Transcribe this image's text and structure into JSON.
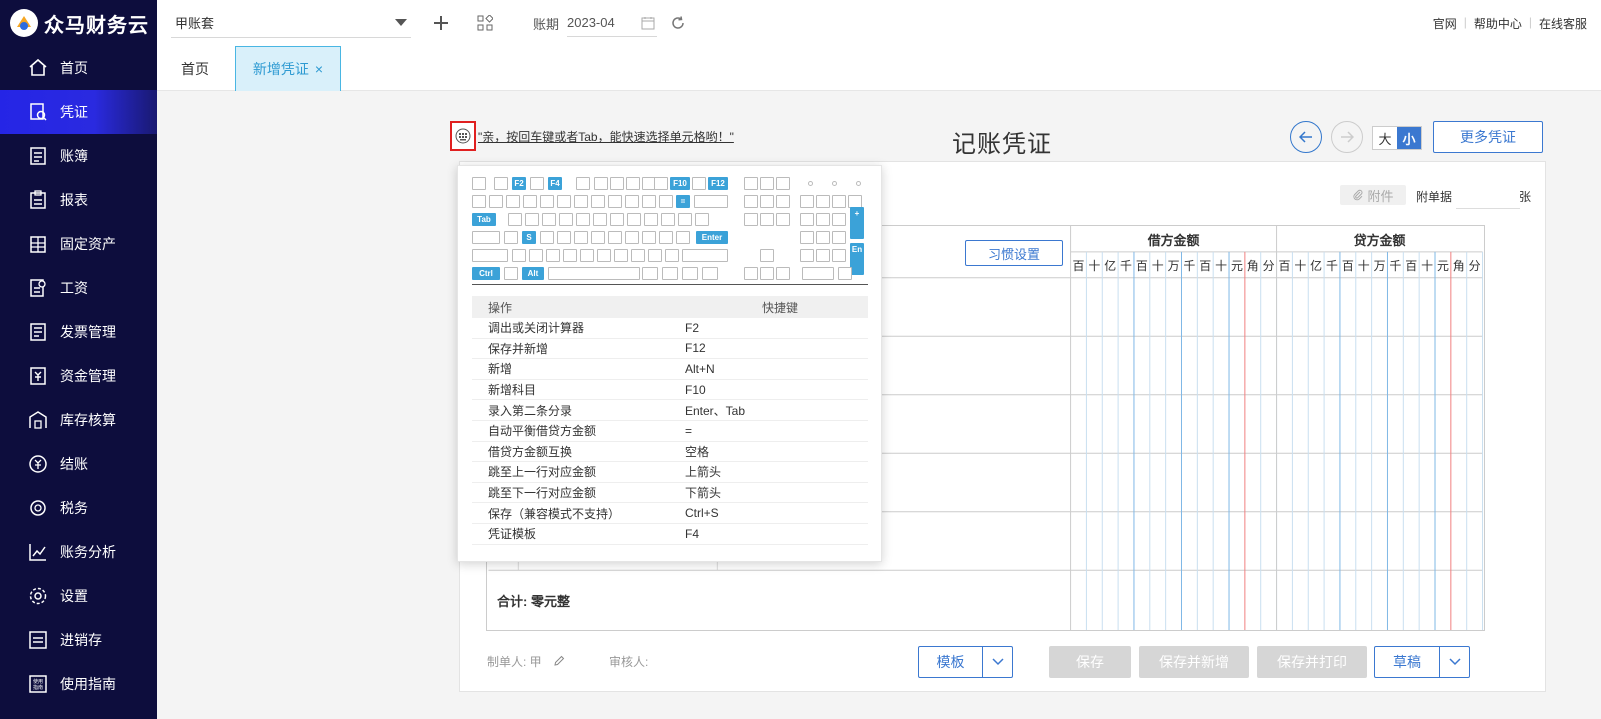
{
  "app": {
    "name": "众马财务云"
  },
  "sidebar": {
    "items": [
      {
        "label": "首页",
        "icon": "home-icon"
      },
      {
        "label": "凭证",
        "icon": "voucher-icon",
        "active": true
      },
      {
        "label": "账簿",
        "icon": "ledger-icon"
      },
      {
        "label": "报表",
        "icon": "report-icon"
      },
      {
        "label": "固定资产",
        "icon": "asset-icon"
      },
      {
        "label": "工资",
        "icon": "salary-icon"
      },
      {
        "label": "发票管理",
        "icon": "invoice-icon"
      },
      {
        "label": "资金管理",
        "icon": "fund-icon"
      },
      {
        "label": "库存核算",
        "icon": "inventory-icon"
      },
      {
        "label": "结账",
        "icon": "closing-icon"
      },
      {
        "label": "税务",
        "icon": "tax-icon"
      },
      {
        "label": "账务分析",
        "icon": "analysis-icon"
      },
      {
        "label": "设置",
        "icon": "settings-icon"
      },
      {
        "label": "进销存",
        "icon": "trade-icon"
      },
      {
        "label": "使用指南",
        "icon": "guide-icon"
      }
    ]
  },
  "topbar": {
    "account": "甲账套",
    "period_label": "账期",
    "period_value": "2023-04",
    "links": [
      "官网",
      "帮助中心",
      "在线客服"
    ]
  },
  "tabs": [
    {
      "label": "首页"
    },
    {
      "label": "新增凭证"
    }
  ],
  "voucher": {
    "hint": "\"亲，按回车键或者Tab，能快速选择单元格哟！\"",
    "title": "记账凭证",
    "size_big": "大",
    "size_small": "小",
    "more_label": "更多凭证",
    "attach_label": "附件",
    "attach_count_label": "附单据",
    "attach_unit": "张",
    "habit_label": "习惯设置",
    "debit_header": "借方金额",
    "credit_header": "贷方金额",
    "digit_units": [
      "百",
      "十",
      "亿",
      "千",
      "百",
      "十",
      "万",
      "千",
      "百",
      "十",
      "元",
      "角",
      "分"
    ],
    "total_label": "合计:  零元整",
    "maker_label": "制单人: 甲",
    "checker_label": "审核人:",
    "buttons": {
      "template": "模板",
      "save": "保存",
      "save_new": "保存并新增",
      "save_print": "保存并打印",
      "draft": "草稿"
    }
  },
  "shortcuts": {
    "keys": {
      "f2": "F2",
      "f4": "F4",
      "f10": "F10",
      "f12": "F12",
      "eq": "=",
      "tab": "Tab",
      "s": "S",
      "enter": "Enter",
      "ctrl": "Ctrl",
      "alt": "Alt",
      "plus": "+",
      "en": "En"
    },
    "col_action": "操作",
    "col_key": "快捷键",
    "rows": [
      {
        "action": "调出或关闭计算器",
        "key": "F2"
      },
      {
        "action": "保存并新增",
        "key": "F12"
      },
      {
        "action": "新增",
        "key": "Alt+N"
      },
      {
        "action": "新增科目",
        "key": "F10"
      },
      {
        "action": "录入第二条分录",
        "key": "Enter、Tab"
      },
      {
        "action": "自动平衡借贷方金额",
        "key": "="
      },
      {
        "action": "借贷方金额互换",
        "key": "空格"
      },
      {
        "action": "跳至上一行对应金额",
        "key": "上箭头"
      },
      {
        "action": "跳至下一行对应金额",
        "key": "下箭头"
      },
      {
        "action": "保存（兼容模式不支持）",
        "key": "Ctrl+S"
      },
      {
        "action": "凭证模板",
        "key": "F4"
      }
    ]
  },
  "colors": {
    "sidebar_bg": "#0d0d3d",
    "active": "#2525e6",
    "accent": "#3b78d0",
    "key_highlight": "#3ba2d8"
  }
}
